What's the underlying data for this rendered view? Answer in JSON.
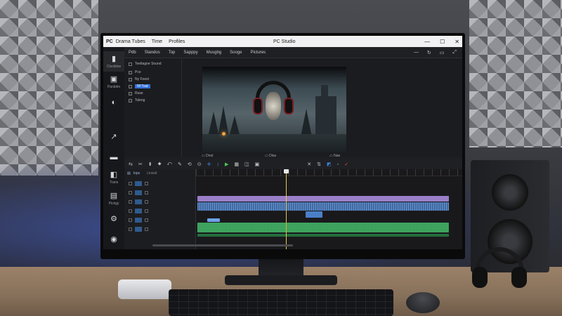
{
  "titlebar": {
    "logo": "PC",
    "menu": [
      "Drama Tubes",
      "Time",
      "Profiles"
    ],
    "center_title": "PC Studio",
    "controls": [
      "—",
      "☐",
      "✕"
    ]
  },
  "rail": {
    "items": [
      {
        "icon": "▮",
        "label": "Clockline"
      },
      {
        "icon": "▣",
        "label": "Panbitm"
      },
      {
        "icon": "◐",
        "label": ""
      },
      {
        "icon": "↗",
        "label": ""
      },
      {
        "icon": "▬",
        "label": ""
      },
      {
        "icon": "◧",
        "label": "Trans"
      },
      {
        "icon": "▤",
        "label": "Pickgy"
      },
      {
        "icon": "⚙",
        "label": ""
      },
      {
        "icon": "◉",
        "label": ""
      }
    ]
  },
  "toolbar": {
    "items": [
      "Pdb",
      "Standos",
      "Top",
      "Sapppy",
      "Musgbg",
      "Sooge",
      "Pictures"
    ],
    "right_icons": [
      "—",
      "↻",
      "▭",
      "⤢"
    ]
  },
  "media": {
    "header": "Teeltagne Sound",
    "rows": [
      {
        "label": "Pce",
        "selected": false
      },
      {
        "label": "Ny Foest",
        "selected": false
      },
      {
        "label": "Nf Toat",
        "selected": true
      },
      {
        "label": "Ruse",
        "selected": false
      },
      {
        "label": "Tsleng",
        "selected": false
      }
    ]
  },
  "preview": {
    "left_ctrl": "▭ Dnst",
    "mid_ctrl": "▭ Dlas",
    "right_ctrl": "▭ Nae"
  },
  "timeline_toolbar": {
    "icons": [
      "⇆",
      "✂",
      "⬍",
      "⬥",
      "⤺",
      "✎",
      "⟲",
      "⊙",
      "✛",
      "↕",
      "▶",
      "▦",
      "◫",
      "▣"
    ],
    "right_icons": [
      "✕",
      "⇅",
      "◩",
      "◦",
      "✓"
    ]
  },
  "timeline": {
    "header_label": "Iops",
    "header_label2": "Linisid",
    "track_rows": 7
  }
}
